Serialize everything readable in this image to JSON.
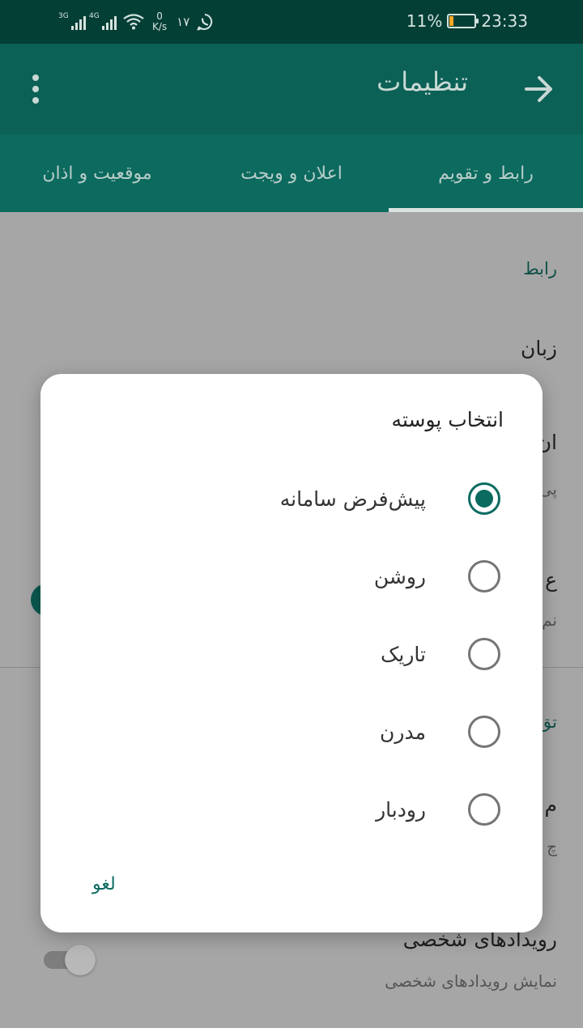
{
  "status_bar": {
    "network1": "3G",
    "network2": "4G",
    "speed_value": "0",
    "speed_unit": "K/s",
    "number": "۱۷",
    "battery": "11%",
    "time": "23:33",
    "battery_level": 0.11,
    "battery_color": "#f5a623"
  },
  "app_bar": {
    "title": "تنظیمات",
    "back_icon": "arrow-right-icon",
    "menu_icon": "more-vert-icon"
  },
  "tabs": [
    {
      "label": "رابط و تقویم",
      "selected": true
    },
    {
      "label": "اعلان و ویجت",
      "selected": false
    },
    {
      "label": "موقعیت و اذان",
      "selected": false
    }
  ],
  "background": {
    "section1": "رابط",
    "item_language": "زبان",
    "partial1": "ان",
    "partial1_sub": "پی",
    "partial2": "ع",
    "partial2_sub": "نم",
    "section2_partial": "تق",
    "partial3": "م",
    "partial3_sub": "چ",
    "personal_events_title": "رویدادهای شخصی",
    "personal_events_sub": "نمایش رویدادهای شخصی"
  },
  "dialog": {
    "title": "انتخاب پوسته",
    "options": [
      {
        "label": "پیش‌فرض سامانه",
        "selected": true
      },
      {
        "label": "روشن",
        "selected": false
      },
      {
        "label": "تاریک",
        "selected": false
      },
      {
        "label": "مدرن",
        "selected": false
      },
      {
        "label": "رودبار",
        "selected": false
      }
    ],
    "cancel_label": "لغو"
  },
  "colors": {
    "status_bar": "#043f36",
    "app_bar": "#0b6156",
    "tabs": "#0c6a5e",
    "accent": "#0b6b60",
    "scrim": "#a6a6a6"
  }
}
